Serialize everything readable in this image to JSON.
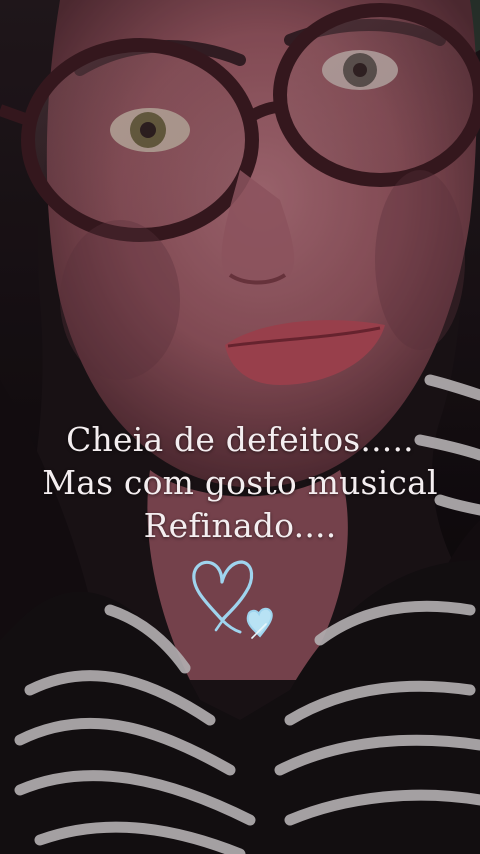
{
  "caption": {
    "line1": "Cheia de defeitos.....",
    "line2": "Mas com gosto musical",
    "line3": "Refinado...."
  },
  "photo": {
    "subject": "selfie-portrait",
    "colors": {
      "skin": "#a8656f",
      "hair": "#120c10",
      "glasses": "#3a1a1e",
      "stripes_dark": "#141012",
      "stripes_light": "#d8d4d6",
      "hearts": "#9fd4ee"
    }
  },
  "decorations": {
    "icons": [
      "heart-outline-icon",
      "small-heart-icon"
    ]
  }
}
